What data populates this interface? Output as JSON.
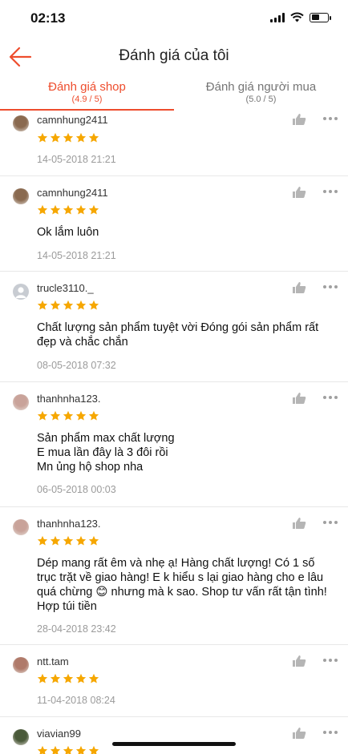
{
  "status_bar": {
    "time": "02:13"
  },
  "header": {
    "title": "Đánh giá của tôi"
  },
  "tabs": [
    {
      "label": "Đánh giá shop",
      "rating": "(4.9 / 5)",
      "active": true
    },
    {
      "label": "Đánh giá người mua",
      "rating": "(5.0 / 5)",
      "active": false
    }
  ],
  "reviews": [
    {
      "username": "camnhung2411",
      "stars": 5,
      "comment": "",
      "date": "14-05-2018 21:21",
      "avatar_color": "#8a6a50"
    },
    {
      "username": "camnhung2411",
      "stars": 5,
      "comment": "Ok lắm luôn",
      "date": "14-05-2018 21:21",
      "avatar_color": "#8a6a50"
    },
    {
      "username": "trucle3110._",
      "stars": 5,
      "comment": " Chất lượng sản phẩm tuyệt vời Đóng gói sản phẩm rất đẹp và chắc chắn",
      "date": "08-05-2018 07:32",
      "avatar_color": "#c8ccd2"
    },
    {
      "username": "thanhnha123.",
      "stars": 5,
      "comment": "Sản phẩm max chất lượng\nE mua lần đây là 3 đôi rồi\nMn ủng hộ shop nha",
      "date": "06-05-2018 00:03",
      "avatar_color": "#c9a39a"
    },
    {
      "username": "thanhnha123.",
      "stars": 5,
      "comment": "Dép mang rất êm và nhẹ ạ! Hàng chất lượng! Có 1 số trục trặt về giao hàng! E k hiểu s lại giao hàng cho e lâu quá chừng 😊 nhưng mà k sao. Shop tư vấn rất tận tình! Hợp túi tiền",
      "date": "28-04-2018 23:42",
      "avatar_color": "#c9a39a"
    },
    {
      "username": "ntt.tam",
      "stars": 5,
      "comment": "",
      "date": "11-04-2018 08:24",
      "avatar_color": "#b07a6a"
    },
    {
      "username": "viavian99",
      "stars": 5,
      "comment": "",
      "date": "",
      "avatar_color": "#4a5a3a"
    }
  ],
  "colors": {
    "accent": "#ee4d2d",
    "star": "#f6a700",
    "muted": "#9b9b9b"
  },
  "icons": {
    "back": "arrow-left-icon",
    "like": "thumbs-up-icon",
    "more": "more-dots-icon",
    "star": "star-icon"
  }
}
